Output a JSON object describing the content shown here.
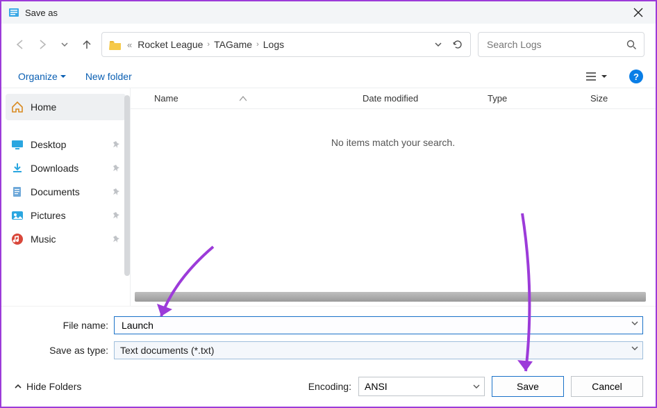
{
  "window": {
    "title": "Save as"
  },
  "breadcrumbs": {
    "sep_first": "«",
    "items": [
      "Rocket League",
      "TAGame",
      "Logs"
    ]
  },
  "search": {
    "placeholder": "Search Logs"
  },
  "toolbar": {
    "organize": "Organize",
    "new_folder": "New folder"
  },
  "sidebar": {
    "home": "Home",
    "items": [
      {
        "label": "Desktop"
      },
      {
        "label": "Downloads"
      },
      {
        "label": "Documents"
      },
      {
        "label": "Pictures"
      },
      {
        "label": "Music"
      }
    ]
  },
  "columns": {
    "name": "Name",
    "date": "Date modified",
    "type": "Type",
    "size": "Size"
  },
  "empty_message": "No items match your search.",
  "form": {
    "filename_label": "File name:",
    "filename_value": "Launch",
    "type_label": "Save as type:",
    "type_value": "Text documents (*.txt)"
  },
  "footer": {
    "hide_folders": "Hide Folders",
    "encoding_label": "Encoding:",
    "encoding_value": "ANSI",
    "save": "Save",
    "cancel": "Cancel"
  },
  "help_glyph": "?"
}
